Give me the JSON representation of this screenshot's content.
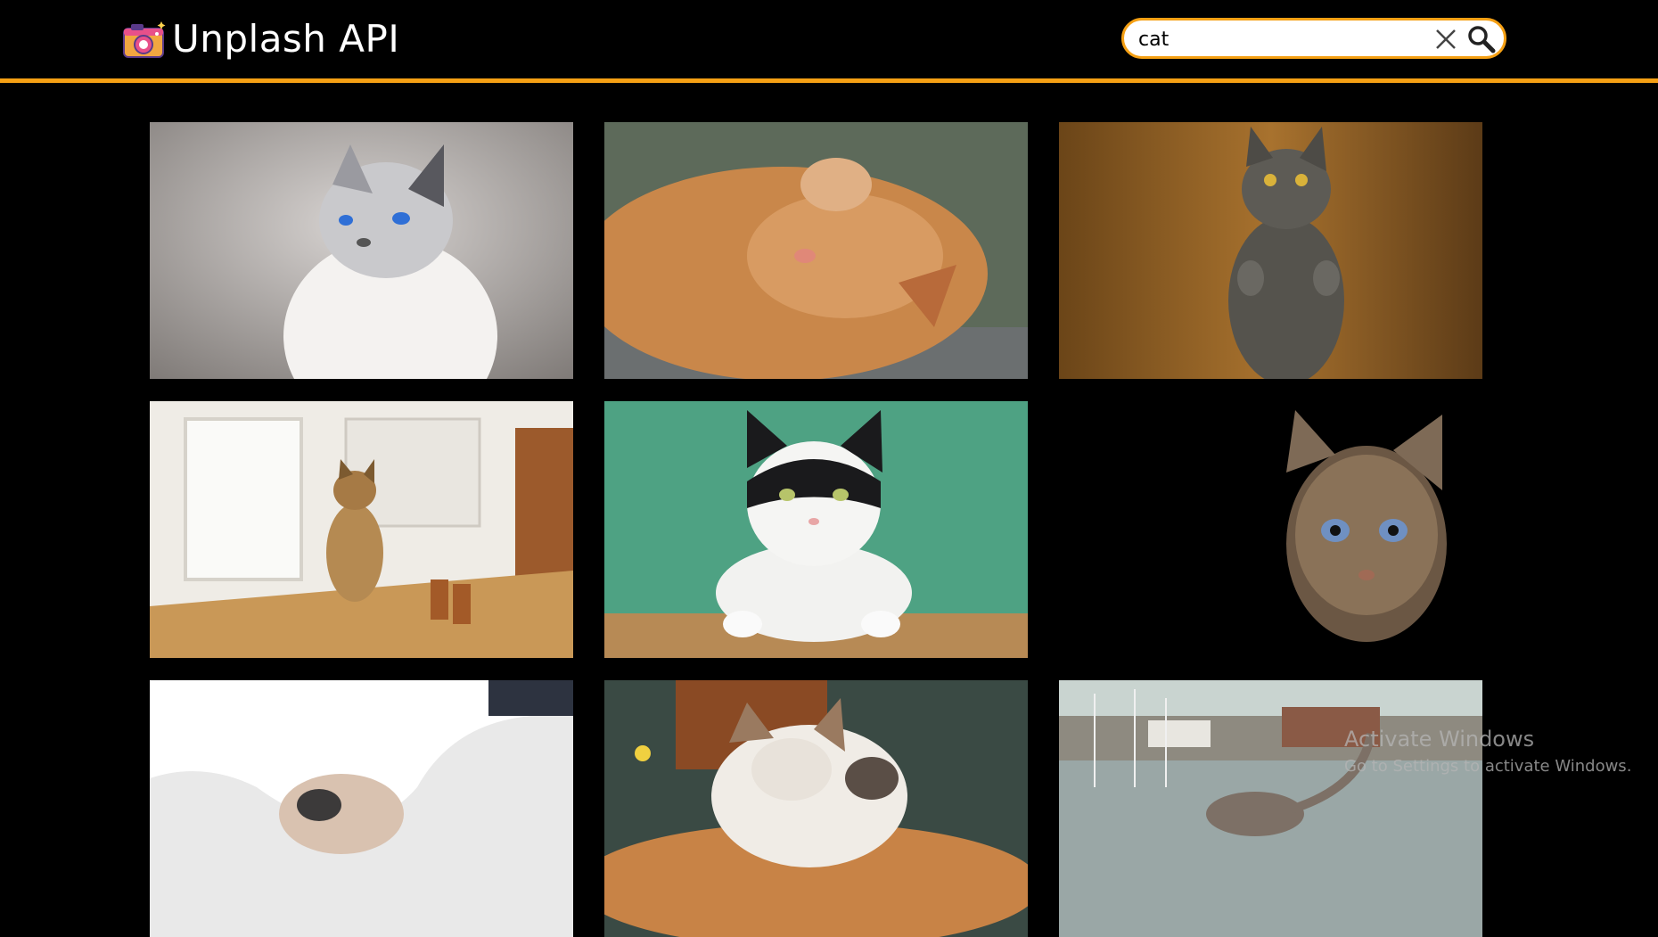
{
  "header": {
    "title": "Unplash API",
    "logo_icon": "camera-icon",
    "accent_color": "#f5a014"
  },
  "search": {
    "value": "cat",
    "clear_icon": "close-icon",
    "submit_icon": "search-icon"
  },
  "results": [
    {
      "subject": "siamese cat looking up"
    },
    {
      "subject": "orange cat sleeping"
    },
    {
      "subject": "grey kitten standing"
    },
    {
      "subject": "tabby cat on kitchen table"
    },
    {
      "subject": "black and white cat on green wall"
    },
    {
      "subject": "tabby cat portrait on black"
    },
    {
      "subject": "cat under white blanket"
    },
    {
      "subject": "calico cat sleeping"
    },
    {
      "subject": "cat at harbour"
    }
  ],
  "watermark": {
    "line1": "Activate Windows",
    "line2": "Go to Settings to activate Windows."
  }
}
